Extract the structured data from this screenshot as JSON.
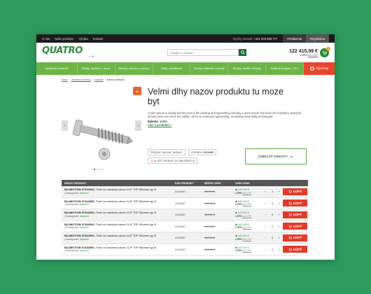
{
  "topbar": {
    "links": [
      "O nás",
      "Naše predajne",
      "Výroba",
      "Kontakt"
    ],
    "contact_label": "Rýchly kontakt:",
    "contact_phone": "+421 903 999 777",
    "login": "Prihlásenie",
    "register": "Registrácia"
  },
  "header": {
    "logo_main": "QUATRO",
    "logo_sub": "L.M",
    "search_placeholder": "Zadajte čo hľadáte",
    "cart_amount": "122 415,99 €",
    "cart_vat": "s DPH",
    "cart_vat_link": "bez DPH",
    "cart_count": "9"
  },
  "nav": {
    "items": [
      "Spojovací materiál",
      "Plasty, výrobky z dreva",
      "Závesy, výsuvy a posuvy",
      "Nohy, rektifikácie",
      "Zámky, kolieska, konzoly",
      "Kľučky, svetlá, úchytky",
      "Drôtený program, LED"
    ],
    "sale": "Výpredaj",
    "sale_icon_text": "%"
  },
  "breadcrumb": [
    "Úvod",
    "Ochranné závesy",
    "Vlasové",
    "Nazov produktu"
  ],
  "product": {
    "badge": "%",
    "title": "Velmi dlhy nazov produktu tu moze byt",
    "description": "Lorem Ipsum is simply dummy text of the printing and typesetting industry. Lorem Ipsum has been the industry's standard dummy text ever since the 1500s, when an unknown typesetting, remaining essentially unchanged.",
    "pack_label": "Balenie:",
    "pack_value": "100ks",
    "more_link": "Viac o produkte >",
    "tag_variant": "PRODUKT MÁ VIAC VARIANT",
    "tag_maker_label": "VÝROBCA:",
    "tag_maker": "FISCHER",
    "tag_fav": "ULOŽIŤ PRODUKT DO OBĽÚBENÝCH",
    "variants_button": "ZOBRAZIŤ VARIANTY"
  },
  "table": {
    "headers": [
      "NÁZOV PRODUKT",
      "KÓD PRODUKT",
      "BEŽNÁ CENA",
      "VAŠA CENA"
    ],
    "rows": [
      {
        "name_bold": "BLUMOTION 973A0500,",
        "name": " Tlmič na naložený záves CLIP TOP /Blumen typ B",
        "avail_label": "Dostupnosť:",
        "avail": "skladom",
        "code": "0425067",
        "old": "442,54 €",
        "price": "442,54 €",
        "vat": "s DPH",
        "novat": "bez DPH",
        "qty": "1",
        "buy": "KÚPIŤ"
      },
      {
        "name_bold": "BLUMOTION 973A0500,",
        "name": " Tlmič na naložený záves CLIP TOP /Blumen typ B",
        "avail_label": "Dostupnosť:",
        "avail": "skladom",
        "code": "0425067",
        "old": "442,54 €",
        "price": "442,54 €",
        "vat": "s DPH",
        "novat": "bez DPH",
        "qty": "1",
        "buy": "KÚPIŤ"
      },
      {
        "name_bold": "BLUMOTION 973A0500,",
        "name": " Tlmič na naložený záves CLIP TOP /Blumen typ B",
        "avail_label": "Dostupnosť:",
        "avail": "skladom",
        "code": "0425067",
        "old": "442,54 €",
        "price": "442,54 €",
        "vat": "s DPH",
        "novat": "bez DPH",
        "qty": "1",
        "buy": "KÚPIŤ"
      },
      {
        "name_bold": "BLUMOTION 973A0500,",
        "name": " Tlmič na naložený záves CLIP TOP /Blumen typ B",
        "avail_label": "Dostupnosť:",
        "avail": "skladom",
        "code": "0425067",
        "old": "442,54 €",
        "price": "442,54 €",
        "vat": "s DPH",
        "novat": "bez DPH",
        "qty": "1",
        "buy": "KÚPIŤ"
      },
      {
        "name_bold": "BLUMOTION 973A0500,",
        "name": " Tlmič na naložený záves CLIP TOP /Blumen typ B",
        "avail_label": "Dostupnosť:",
        "avail": "skladom",
        "code": "0425067",
        "old": "442,54 €",
        "price": "442,54 €",
        "vat": "s DPH",
        "novat": "bez DPH",
        "qty": "1",
        "buy": "KÚPIŤ"
      },
      {
        "name_bold": "BLUMOTION 973A0500,",
        "name": " Tlmič na naložený záves CLIP TOP /Blumen typ B",
        "avail_label": "Dostupnosť:",
        "avail": "skladom",
        "code": "0425067",
        "old": "442,54 €",
        "price": "442,54 €",
        "vat": "s DPH",
        "novat": "bez DPH",
        "qty": "1",
        "buy": "KÚPIŤ"
      }
    ]
  },
  "colors": {
    "background": "#2e9a5c",
    "brand_green": "#2e8b3a",
    "nav_green": "#6cb646",
    "sale_orange": "#e8472b",
    "buy_red": "#e23b2a"
  }
}
